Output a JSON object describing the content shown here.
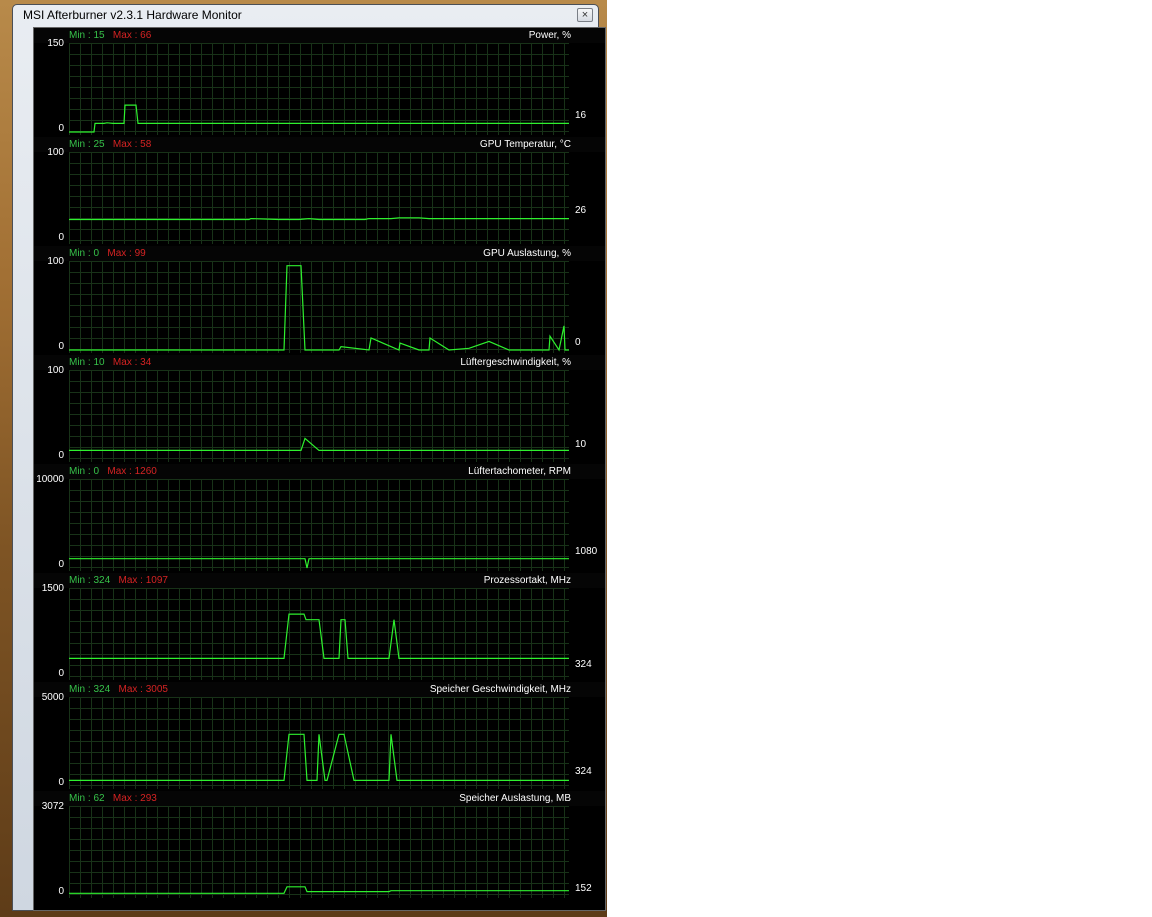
{
  "window": {
    "title": "MSI Afterburner v2.3.1 Hardware Monitor"
  },
  "labels": {
    "min": "Min :",
    "max": "Max :"
  },
  "colors": {
    "trace": "#2ef02e",
    "min_text": "#37c24a",
    "max_text": "#d52323",
    "grid": "#183218"
  },
  "panels": [
    {
      "title": "Power, %",
      "min": "15",
      "max": "66",
      "ymax": "150",
      "ymin": "0",
      "current": "16",
      "chart_data": {
        "type": "line",
        "ylim": [
          0,
          150
        ],
        "x": [
          0,
          20,
          25,
          26,
          35,
          38,
          44,
          55,
          56,
          58,
          66,
          67,
          69,
          80,
          84,
          86,
          88,
          100,
          150,
          180,
          210,
          240,
          270,
          300,
          320,
          321,
          330,
          340,
          342,
          350,
          356,
          360,
          364,
          366,
          400,
          430,
          460,
          490,
          500
        ],
        "y": [
          0,
          0,
          0,
          15,
          15,
          16,
          15,
          15,
          47,
          47,
          47,
          47,
          15,
          15,
          15,
          15,
          15,
          15,
          15,
          15,
          15,
          15,
          15,
          15,
          15,
          15,
          15,
          15,
          15,
          15,
          15,
          15,
          15,
          15,
          15,
          15,
          15,
          15,
          15
        ]
      }
    },
    {
      "title": "GPU Temperatur, °C",
      "min": "25",
      "max": "58",
      "ymax": "100",
      "ymin": "0",
      "current": "26",
      "chart_data": {
        "type": "line",
        "ylim": [
          0,
          100
        ],
        "x": [
          0,
          180,
          182,
          210,
          214,
          220,
          230,
          240,
          250,
          258,
          262,
          280,
          296,
          300,
          318,
          322,
          330,
          340,
          345,
          350,
          360,
          380,
          400,
          420,
          440,
          460,
          480,
          500
        ],
        "y": [
          25,
          25,
          26,
          25,
          25,
          25,
          25,
          26,
          25,
          25,
          25,
          25,
          25,
          26,
          26,
          26,
          27,
          27,
          27,
          27,
          26,
          26,
          26,
          26,
          26,
          26,
          26,
          26
        ]
      }
    },
    {
      "title": "GPU Auslastung, %",
      "min": "0",
      "max": "99",
      "ymax": "100",
      "ymin": "0",
      "current": "0",
      "chart_data": {
        "type": "line",
        "ylim": [
          0,
          100
        ],
        "x": [
          0,
          165,
          215,
          218,
          232,
          236,
          270,
          272,
          300,
          302,
          330,
          331,
          350,
          360,
          361,
          380,
          400,
          420,
          440,
          460,
          480,
          481,
          490,
          495,
          496,
          500
        ],
        "y": [
          0,
          0,
          0,
          98,
          98,
          0,
          0,
          4,
          0,
          14,
          0,
          8,
          0,
          0,
          14,
          0,
          2,
          10,
          0,
          0,
          0,
          16,
          0,
          28,
          0,
          0
        ]
      }
    },
    {
      "title": "Lüftergeschwindigkeit, %",
      "min": "10",
      "max": "34",
      "ymax": "100",
      "ymin": "0",
      "current": "10",
      "chart_data": {
        "type": "line",
        "ylim": [
          0,
          100
        ],
        "x": [
          0,
          165,
          232,
          236,
          250,
          500
        ],
        "y": [
          10,
          10,
          10,
          24,
          10,
          10
        ]
      }
    },
    {
      "title": "Lüftertachometer, RPM",
      "min": "0",
      "max": "1260",
      "ymax": "10000",
      "ymin": "0",
      "current": "1080",
      "chart_data": {
        "type": "line",
        "ylim": [
          0,
          10000
        ],
        "x": [
          0,
          165,
          236,
          238,
          240,
          500
        ],
        "y": [
          1080,
          1080,
          1080,
          0,
          1080,
          1080
        ]
      }
    },
    {
      "title": "Prozessortakt, MHz",
      "min": "324",
      "max": "1097",
      "ymax": "1500",
      "ymin": "0",
      "current": "324",
      "chart_data": {
        "type": "line",
        "ylim": [
          0,
          1500
        ],
        "x": [
          0,
          165,
          215,
          220,
          235,
          237,
          250,
          255,
          270,
          272,
          276,
          279,
          290,
          320,
          325,
          330,
          500
        ],
        "y": [
          324,
          324,
          324,
          1097,
          1097,
          1000,
          1000,
          324,
          324,
          1000,
          1000,
          324,
          324,
          324,
          1000,
          324,
          324
        ]
      }
    },
    {
      "title": "Speicher Geschwindigkeit, MHz",
      "min": "324",
      "max": "3005",
      "ymax": "5000",
      "ymin": "0",
      "current": "324",
      "chart_data": {
        "type": "line",
        "ylim": [
          0,
          5000
        ],
        "x": [
          0,
          165,
          215,
          220,
          235,
          238,
          248,
          250,
          256,
          258,
          270,
          275,
          285,
          320,
          322,
          328,
          500
        ],
        "y": [
          324,
          324,
          324,
          3005,
          3005,
          324,
          324,
          3005,
          324,
          324,
          3005,
          3005,
          324,
          324,
          3005,
          324,
          324
        ]
      }
    },
    {
      "title": "Speicher Auslastung, MB",
      "min": "62",
      "max": "293",
      "ymax": "3072",
      "ymin": "0",
      "current": "152",
      "chart_data": {
        "type": "line",
        "ylim": [
          0,
          3072
        ],
        "x": [
          0,
          165,
          215,
          218,
          236,
          238,
          320,
          322,
          500
        ],
        "y": [
          62,
          62,
          62,
          293,
          293,
          120,
          120,
          152,
          152
        ]
      }
    }
  ]
}
